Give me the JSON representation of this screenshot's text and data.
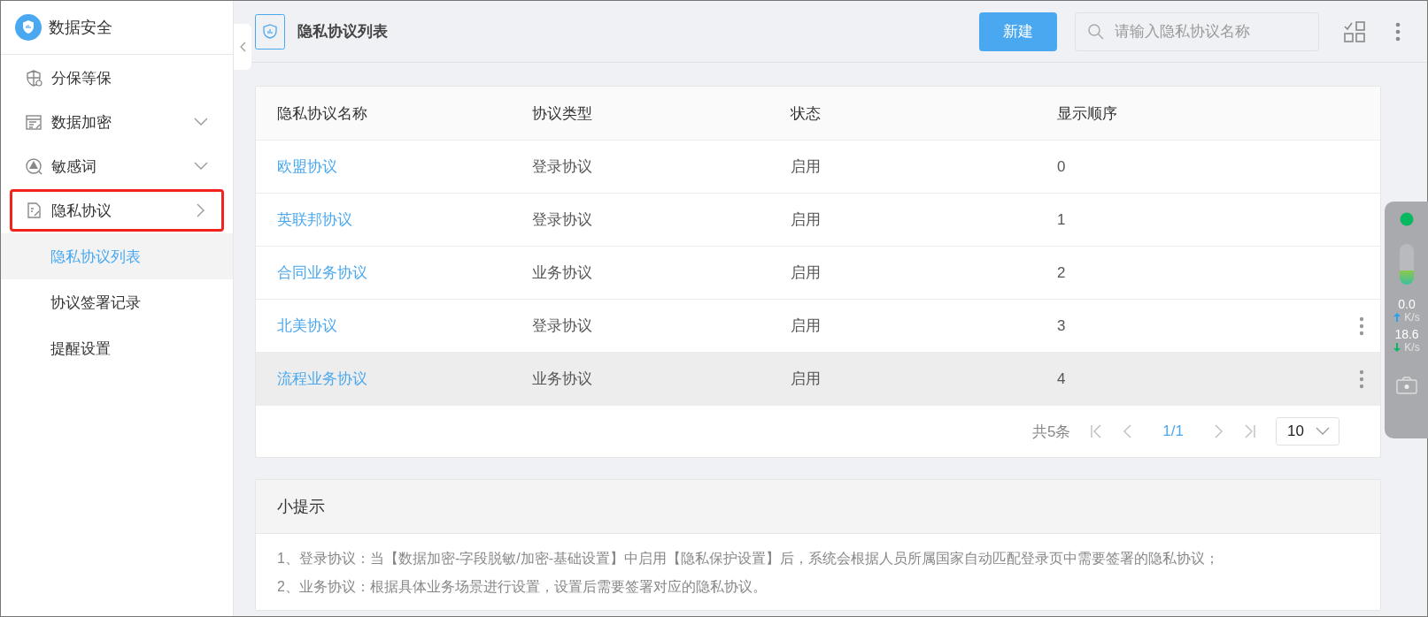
{
  "app": {
    "title": "数据安全"
  },
  "sidebar": {
    "items": [
      {
        "label": "分保等保",
        "kind": "plain",
        "highlighted": false
      },
      {
        "label": "数据加密",
        "kind": "collapsed",
        "highlighted": false
      },
      {
        "label": "敏感词",
        "kind": "collapsed",
        "highlighted": false
      },
      {
        "label": "隐私协议",
        "kind": "expanded",
        "highlighted": true,
        "children": [
          {
            "label": "隐私协议列表",
            "selected": true
          },
          {
            "label": "协议签署记录",
            "selected": false
          },
          {
            "label": "提醒设置",
            "selected": false
          }
        ]
      }
    ]
  },
  "header": {
    "title": "隐私协议列表",
    "new_button": "新建",
    "search": {
      "placeholder": "请输入隐私协议名称"
    }
  },
  "table": {
    "columns": [
      "隐私协议名称",
      "协议类型",
      "状态",
      "显示顺序"
    ],
    "rows": [
      {
        "name": "欧盟协议",
        "type": "登录协议",
        "status": "启用",
        "order": "0",
        "hovered": false,
        "menu": false
      },
      {
        "name": "英联邦协议",
        "type": "登录协议",
        "status": "启用",
        "order": "1",
        "hovered": false,
        "menu": false
      },
      {
        "name": "合同业务协议",
        "type": "业务协议",
        "status": "启用",
        "order": "2",
        "hovered": false,
        "menu": false
      },
      {
        "name": "北美协议",
        "type": "登录协议",
        "status": "启用",
        "order": "3",
        "hovered": false,
        "menu": true
      },
      {
        "name": "流程业务协议",
        "type": "业务协议",
        "status": "启用",
        "order": "4",
        "hovered": true,
        "menu": true
      }
    ]
  },
  "pagination": {
    "total": "共5条",
    "page": "1/1",
    "page_size": "10"
  },
  "tips": {
    "title": "小提示",
    "lines": [
      "1、登录协议：当【数据加密-字段脱敏/加密-基础设置】中启用【隐私保护设置】后，系统会根据人员所属国家自动匹配登录页中需要签署的隐私协议；",
      "2、业务协议：根据具体业务场景进行设置，设置后需要签署对应的隐私协议。"
    ]
  },
  "monitor": {
    "level": 0.35,
    "upload": "0.0",
    "upload_unit": "K/s",
    "download": "18.6",
    "download_unit": "K/s"
  }
}
